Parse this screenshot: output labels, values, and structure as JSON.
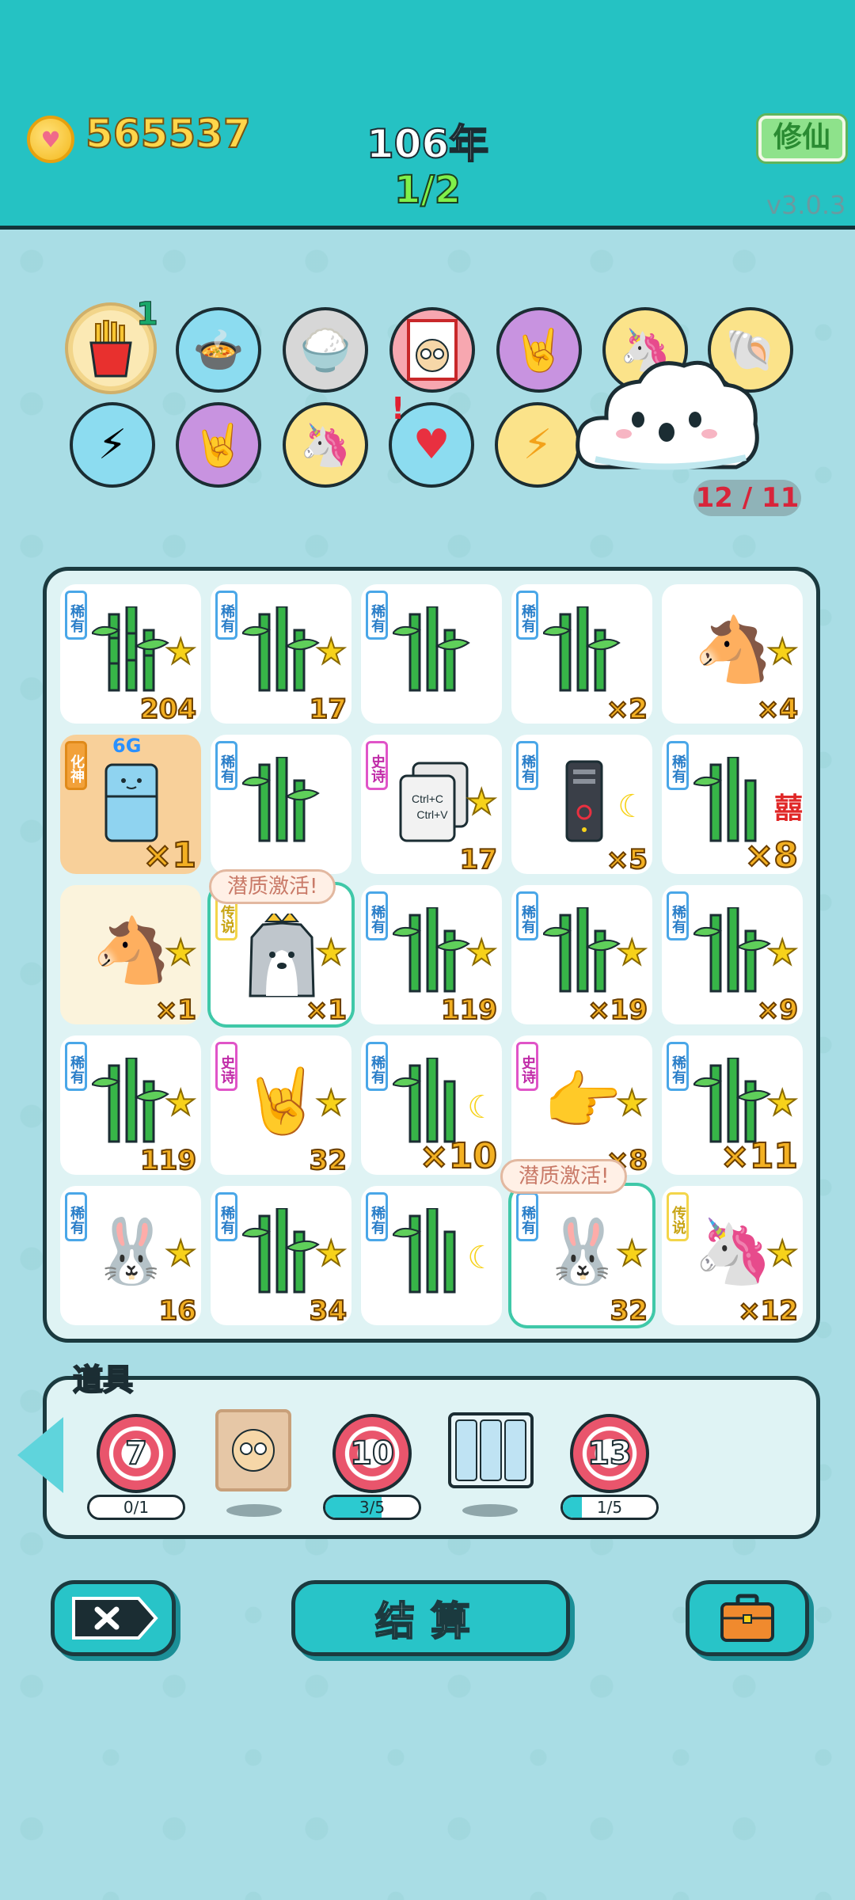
{
  "header": {
    "coins": "565537",
    "year": "106年",
    "round": "1/2",
    "cultivate_label": "修仙",
    "version": "v3.0.3"
  },
  "relics": {
    "count": "12 / 11",
    "first_badge": "1",
    "alert_mark": "!"
  },
  "board": {
    "tooltip": "潜质激活!",
    "label_6g": "6G",
    "xi_char": "囍",
    "rarity": {
      "rare": "稀有",
      "epic": "史诗",
      "legend": "传说",
      "god": "化神"
    },
    "cells": [
      {
        "tag": "稀有",
        "value": "204"
      },
      {
        "tag": "稀有",
        "value": "17"
      },
      {
        "tag": "稀有",
        "value": ""
      },
      {
        "tag": "稀有",
        "value": "×2"
      },
      {
        "tag": "",
        "value": "×4"
      },
      {
        "tag": "化神",
        "value": "×1"
      },
      {
        "tag": "稀有",
        "value": ""
      },
      {
        "tag": "史诗",
        "value": "17"
      },
      {
        "tag": "稀有",
        "value": "×5"
      },
      {
        "tag": "稀有",
        "value": "×8"
      },
      {
        "tag": "",
        "value": "×1"
      },
      {
        "tag": "传说",
        "value": "×1"
      },
      {
        "tag": "稀有",
        "value": "119"
      },
      {
        "tag": "稀有",
        "value": "×19"
      },
      {
        "tag": "稀有",
        "value": "×9"
      },
      {
        "tag": "稀有",
        "value": "119"
      },
      {
        "tag": "史诗",
        "value": "32"
      },
      {
        "tag": "稀有",
        "value": "×10"
      },
      {
        "tag": "史诗",
        "value": "×8"
      },
      {
        "tag": "稀有",
        "value": "×11"
      },
      {
        "tag": "稀有",
        "value": "16"
      },
      {
        "tag": "稀有",
        "value": "34"
      },
      {
        "tag": "稀有",
        "value": ""
      },
      {
        "tag": "稀有",
        "value": "32"
      },
      {
        "tag": "传说",
        "value": "×12"
      }
    ],
    "ctrl_text": "Ctrl+C\nCtrl+V"
  },
  "items": {
    "title": "道具",
    "slots": [
      {
        "number": "7",
        "progress": "0/1",
        "fraction": 0.0
      },
      {
        "number": "10",
        "progress": "3/5",
        "fraction": 0.6
      },
      {
        "number": "13",
        "progress": "1/5",
        "fraction": 0.2
      }
    ]
  },
  "buttons": {
    "settle_label": "结算"
  }
}
